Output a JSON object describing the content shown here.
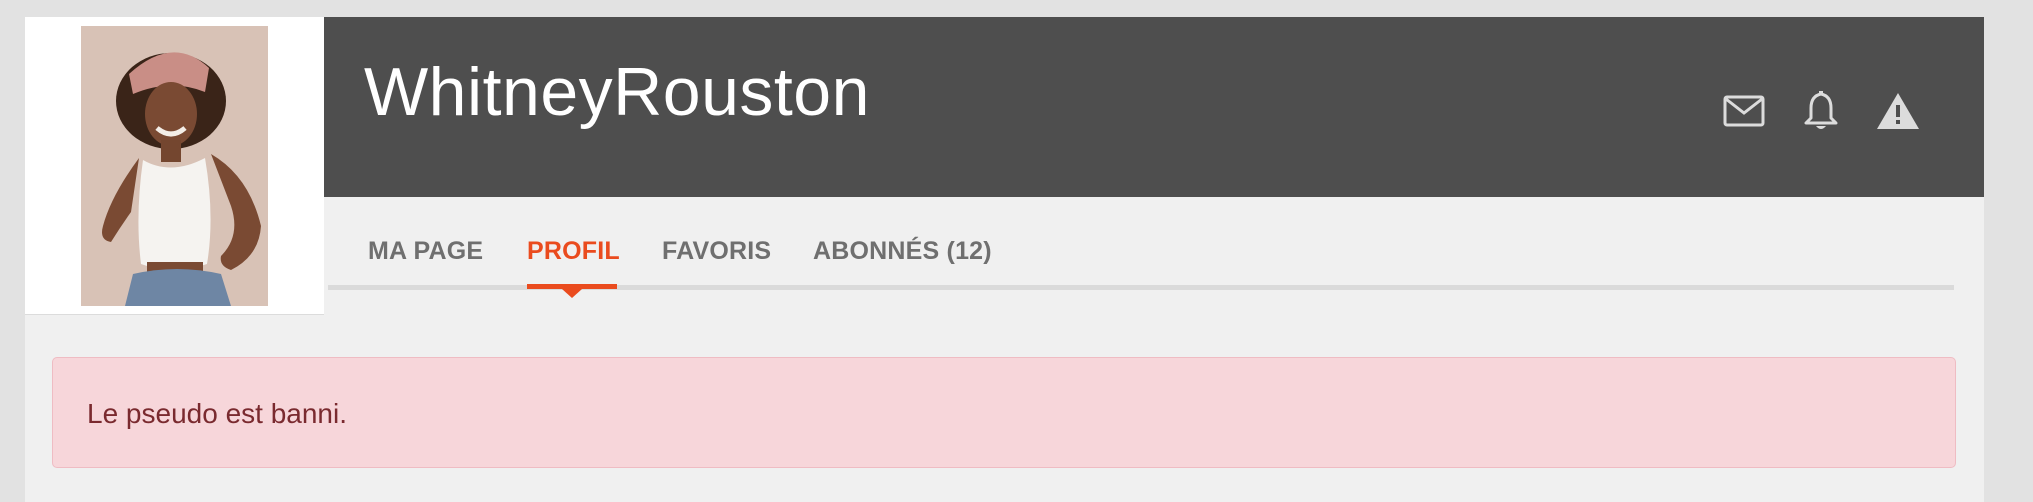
{
  "profile": {
    "username": "WhitneyRouston"
  },
  "header_icons": [
    {
      "name": "mail-icon"
    },
    {
      "name": "bell-icon"
    },
    {
      "name": "warning-icon"
    }
  ],
  "tabs": [
    {
      "label": "MA PAGE",
      "active": false
    },
    {
      "label": "PROFIL",
      "active": true
    },
    {
      "label": "FAVORIS",
      "active": false
    },
    {
      "label": "ABONNÉS (12)",
      "active": false
    }
  ],
  "alert": {
    "message": "Le pseudo est banni."
  },
  "colors": {
    "header_bg": "#4e4e4e",
    "accent": "#ea4b1e",
    "alert_bg": "#f7d6da",
    "alert_text": "#7a2a2f"
  }
}
